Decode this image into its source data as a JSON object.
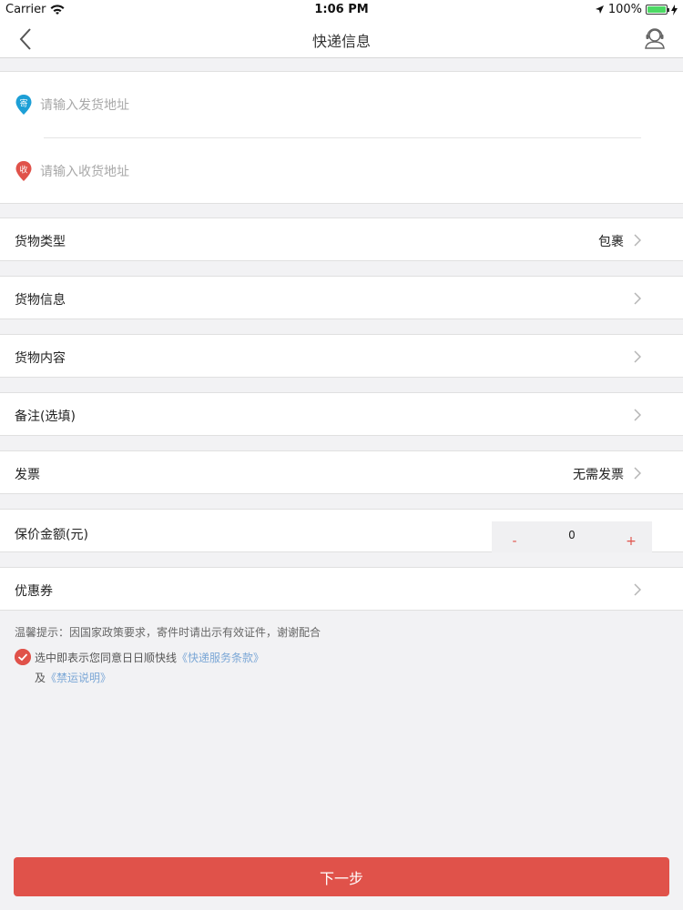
{
  "status_bar": {
    "carrier": "Carrier",
    "time": "1:06 PM",
    "battery": "100%",
    "battery_level": 1.0
  },
  "nav": {
    "title": "快递信息",
    "back_icon": "chevron-left-icon",
    "service_icon": "customer-service-icon"
  },
  "address": {
    "send": {
      "badge": "寄",
      "placeholder": "请输入发货地址",
      "value": "",
      "color": "#1d9fd6"
    },
    "receive": {
      "badge": "收",
      "placeholder": "请输入收货地址",
      "value": "",
      "color": "#e0524a"
    }
  },
  "rows": {
    "cargo_type": {
      "label": "货物类型",
      "value": "包裹"
    },
    "cargo_info": {
      "label": "货物信息"
    },
    "cargo_content": {
      "label": "货物内容"
    },
    "remark": {
      "label": "备注(选填)"
    },
    "invoice": {
      "label": "发票",
      "value": "无需发票"
    },
    "insured": {
      "label": "保价金额(元)",
      "minus": "-",
      "quantity": "0",
      "plus": "+"
    },
    "coupon": {
      "label": "优惠券"
    }
  },
  "notice": {
    "tip": "温馨提示：因国家政策要求，寄件时请出示有效证件，谢谢配合",
    "agree_prefix": "选中即表示您同意日日顺快线",
    "service_terms": "《快递服务条款》",
    "and": "及",
    "prohibited": "《禁运说明》"
  },
  "next_button": "下一步",
  "colors": {
    "accent": "#e0524a",
    "link": "#7ba7d6",
    "send_pin": "#1d9fd6"
  }
}
